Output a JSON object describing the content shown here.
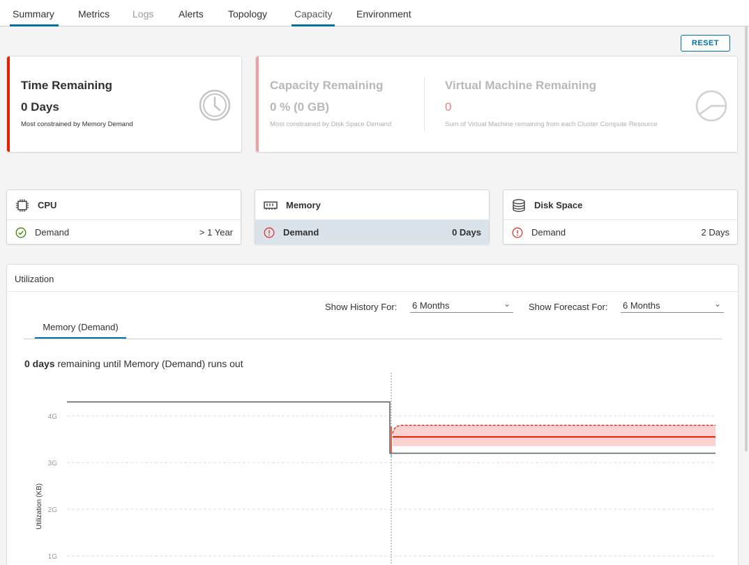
{
  "tabs": [
    {
      "label": "Summary",
      "state": "underlined"
    },
    {
      "label": "Metrics",
      "state": "normal"
    },
    {
      "label": "Logs",
      "state": "disabled"
    },
    {
      "label": "Alerts",
      "state": "normal"
    },
    {
      "label": "Topology",
      "state": "normal"
    },
    {
      "label": "Capacity",
      "state": "active"
    },
    {
      "label": "Environment",
      "state": "normal"
    }
  ],
  "reset_label": "RESET",
  "summary": {
    "time": {
      "title": "Time Remaining",
      "value": "0 Days",
      "note": "Most constrained by Memory Demand",
      "icon": "clock-icon",
      "accent": "#e12200"
    },
    "capacity": {
      "title": "Capacity Remaining",
      "value": "0 % (0 GB)",
      "note": "Most constrained by Disk Space Demand",
      "accent": "#f0a0a0"
    },
    "vm": {
      "title": "Virtual Machine Remaining",
      "value": "0",
      "value_color": "#f08080",
      "note": "Sum of Virtual Machine remaining from each Cluster Compute Resource",
      "icon": "pie-chart-icon"
    }
  },
  "resources": [
    {
      "name": "CPU",
      "icon": "cpu-icon",
      "row_label": "Demand",
      "row_value": "> 1 Year",
      "status": "ok",
      "selected": false
    },
    {
      "name": "Memory",
      "icon": "memory-icon",
      "row_label": "Demand",
      "row_value": "0 Days",
      "status": "critical",
      "selected": true
    },
    {
      "name": "Disk Space",
      "icon": "database-icon",
      "row_label": "Demand",
      "row_value": "2 Days",
      "status": "critical",
      "selected": false
    }
  ],
  "utilization": {
    "title": "Utilization",
    "history_label": "Show History For:",
    "history_value": "6 Months",
    "forecast_label": "Show Forecast For:",
    "forecast_value": "6 Months",
    "subtab": "Memory (Demand)",
    "remaining_bold": "0 days",
    "remaining_text": " remaining until Memory (Demand) runs out"
  },
  "chart_data": {
    "type": "line",
    "ylabel": "Utilization (KB)",
    "y_ticks": [
      "1G",
      "2G",
      "3G",
      "4G"
    ],
    "ylim": [
      1,
      5
    ],
    "grid": true,
    "series": [
      {
        "values_history": [
          4.3,
          4.3
        ],
        "values_after_now": [
          3.2,
          3.2
        ],
        "color": "#666666"
      },
      {
        "values_forecast": [
          3.55,
          3.55
        ],
        "band": [
          3.35,
          3.8
        ],
        "color": "#e12200"
      }
    ],
    "colors": {
      "history": "#666666",
      "forecast": "#e12200",
      "band": "#f9c9c9"
    }
  }
}
